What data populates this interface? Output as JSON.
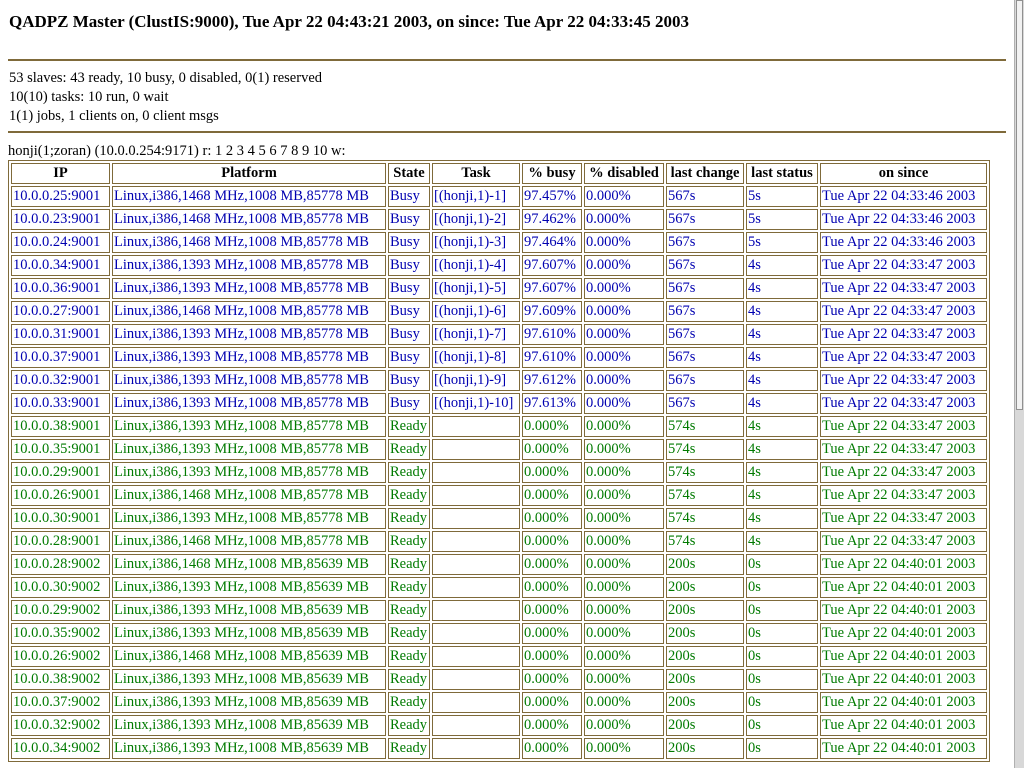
{
  "header": {
    "title": "QADPZ Master (ClustIS:9000), Tue Apr 22 04:43:21 2003, on since: Tue Apr 22 04:33:45 2003"
  },
  "summary": {
    "slaves": "53 slaves: 43 ready, 10 busy, 0 disabled, 0(1) reserved",
    "tasks": "10(10) tasks: 10 run, 0 wait",
    "jobs": "1(1) jobs, 1 clients on, 0 client msgs"
  },
  "job_line": "honji(1;zoran) (10.0.0.254:9171) r: 1 2 3 4 5 6 7 8 9 10 w:",
  "table": {
    "headers": [
      "IP",
      "Platform",
      "State",
      "Task",
      "% busy",
      "% disabled",
      "last change",
      "last status",
      "on since"
    ],
    "rows": [
      {
        "kind": "busy",
        "cells": [
          "10.0.0.25:9001",
          "Linux,i386,1468 MHz,1008 MB,85778 MB",
          "Busy",
          "[(honji,1)-1]",
          "97.457%",
          "0.000%",
          "567s",
          "5s",
          "Tue Apr 22 04:33:46 2003"
        ]
      },
      {
        "kind": "busy",
        "cells": [
          "10.0.0.23:9001",
          "Linux,i386,1468 MHz,1008 MB,85778 MB",
          "Busy",
          "[(honji,1)-2]",
          "97.462%",
          "0.000%",
          "567s",
          "5s",
          "Tue Apr 22 04:33:46 2003"
        ]
      },
      {
        "kind": "busy",
        "cells": [
          "10.0.0.24:9001",
          "Linux,i386,1468 MHz,1008 MB,85778 MB",
          "Busy",
          "[(honji,1)-3]",
          "97.464%",
          "0.000%",
          "567s",
          "5s",
          "Tue Apr 22 04:33:46 2003"
        ]
      },
      {
        "kind": "busy",
        "cells": [
          "10.0.0.34:9001",
          "Linux,i386,1393 MHz,1008 MB,85778 MB",
          "Busy",
          "[(honji,1)-4]",
          "97.607%",
          "0.000%",
          "567s",
          "4s",
          "Tue Apr 22 04:33:47 2003"
        ]
      },
      {
        "kind": "busy",
        "cells": [
          "10.0.0.36:9001",
          "Linux,i386,1393 MHz,1008 MB,85778 MB",
          "Busy",
          "[(honji,1)-5]",
          "97.607%",
          "0.000%",
          "567s",
          "4s",
          "Tue Apr 22 04:33:47 2003"
        ]
      },
      {
        "kind": "busy",
        "cells": [
          "10.0.0.27:9001",
          "Linux,i386,1468 MHz,1008 MB,85778 MB",
          "Busy",
          "[(honji,1)-6]",
          "97.609%",
          "0.000%",
          "567s",
          "4s",
          "Tue Apr 22 04:33:47 2003"
        ]
      },
      {
        "kind": "busy",
        "cells": [
          "10.0.0.31:9001",
          "Linux,i386,1393 MHz,1008 MB,85778 MB",
          "Busy",
          "[(honji,1)-7]",
          "97.610%",
          "0.000%",
          "567s",
          "4s",
          "Tue Apr 22 04:33:47 2003"
        ]
      },
      {
        "kind": "busy",
        "cells": [
          "10.0.0.37:9001",
          "Linux,i386,1393 MHz,1008 MB,85778 MB",
          "Busy",
          "[(honji,1)-8]",
          "97.610%",
          "0.000%",
          "567s",
          "4s",
          "Tue Apr 22 04:33:47 2003"
        ]
      },
      {
        "kind": "busy",
        "cells": [
          "10.0.0.32:9001",
          "Linux,i386,1393 MHz,1008 MB,85778 MB",
          "Busy",
          "[(honji,1)-9]",
          "97.612%",
          "0.000%",
          "567s",
          "4s",
          "Tue Apr 22 04:33:47 2003"
        ]
      },
      {
        "kind": "busy",
        "cells": [
          "10.0.0.33:9001",
          "Linux,i386,1393 MHz,1008 MB,85778 MB",
          "Busy",
          "[(honji,1)-10]",
          "97.613%",
          "0.000%",
          "567s",
          "4s",
          "Tue Apr 22 04:33:47 2003"
        ]
      },
      {
        "kind": "ready",
        "cells": [
          "10.0.0.38:9001",
          "Linux,i386,1393 MHz,1008 MB,85778 MB",
          "Ready",
          "",
          "0.000%",
          "0.000%",
          "574s",
          "4s",
          "Tue Apr 22 04:33:47 2003"
        ]
      },
      {
        "kind": "ready",
        "cells": [
          "10.0.0.35:9001",
          "Linux,i386,1393 MHz,1008 MB,85778 MB",
          "Ready",
          "",
          "0.000%",
          "0.000%",
          "574s",
          "4s",
          "Tue Apr 22 04:33:47 2003"
        ]
      },
      {
        "kind": "ready",
        "cells": [
          "10.0.0.29:9001",
          "Linux,i386,1393 MHz,1008 MB,85778 MB",
          "Ready",
          "",
          "0.000%",
          "0.000%",
          "574s",
          "4s",
          "Tue Apr 22 04:33:47 2003"
        ]
      },
      {
        "kind": "ready",
        "cells": [
          "10.0.0.26:9001",
          "Linux,i386,1468 MHz,1008 MB,85778 MB",
          "Ready",
          "",
          "0.000%",
          "0.000%",
          "574s",
          "4s",
          "Tue Apr 22 04:33:47 2003"
        ]
      },
      {
        "kind": "ready",
        "cells": [
          "10.0.0.30:9001",
          "Linux,i386,1393 MHz,1008 MB,85778 MB",
          "Ready",
          "",
          "0.000%",
          "0.000%",
          "574s",
          "4s",
          "Tue Apr 22 04:33:47 2003"
        ]
      },
      {
        "kind": "ready",
        "cells": [
          "10.0.0.28:9001",
          "Linux,i386,1468 MHz,1008 MB,85778 MB",
          "Ready",
          "",
          "0.000%",
          "0.000%",
          "574s",
          "4s",
          "Tue Apr 22 04:33:47 2003"
        ]
      },
      {
        "kind": "ready",
        "cells": [
          "10.0.0.28:9002",
          "Linux,i386,1468 MHz,1008 MB,85639 MB",
          "Ready",
          "",
          "0.000%",
          "0.000%",
          "200s",
          "0s",
          "Tue Apr 22 04:40:01 2003"
        ]
      },
      {
        "kind": "ready",
        "cells": [
          "10.0.0.30:9002",
          "Linux,i386,1393 MHz,1008 MB,85639 MB",
          "Ready",
          "",
          "0.000%",
          "0.000%",
          "200s",
          "0s",
          "Tue Apr 22 04:40:01 2003"
        ]
      },
      {
        "kind": "ready",
        "cells": [
          "10.0.0.29:9002",
          "Linux,i386,1393 MHz,1008 MB,85639 MB",
          "Ready",
          "",
          "0.000%",
          "0.000%",
          "200s",
          "0s",
          "Tue Apr 22 04:40:01 2003"
        ]
      },
      {
        "kind": "ready",
        "cells": [
          "10.0.0.35:9002",
          "Linux,i386,1393 MHz,1008 MB,85639 MB",
          "Ready",
          "",
          "0.000%",
          "0.000%",
          "200s",
          "0s",
          "Tue Apr 22 04:40:01 2003"
        ]
      },
      {
        "kind": "ready",
        "cells": [
          "10.0.0.26:9002",
          "Linux,i386,1468 MHz,1008 MB,85639 MB",
          "Ready",
          "",
          "0.000%",
          "0.000%",
          "200s",
          "0s",
          "Tue Apr 22 04:40:01 2003"
        ]
      },
      {
        "kind": "ready",
        "cells": [
          "10.0.0.38:9002",
          "Linux,i386,1393 MHz,1008 MB,85639 MB",
          "Ready",
          "",
          "0.000%",
          "0.000%",
          "200s",
          "0s",
          "Tue Apr 22 04:40:01 2003"
        ]
      },
      {
        "kind": "ready",
        "cells": [
          "10.0.0.37:9002",
          "Linux,i386,1393 MHz,1008 MB,85639 MB",
          "Ready",
          "",
          "0.000%",
          "0.000%",
          "200s",
          "0s",
          "Tue Apr 22 04:40:01 2003"
        ]
      },
      {
        "kind": "ready",
        "cells": [
          "10.0.0.32:9002",
          "Linux,i386,1393 MHz,1008 MB,85639 MB",
          "Ready",
          "",
          "0.000%",
          "0.000%",
          "200s",
          "0s",
          "Tue Apr 22 04:40:01 2003"
        ]
      },
      {
        "kind": "ready",
        "cells": [
          "10.0.0.34:9002",
          "Linux,i386,1393 MHz,1008 MB,85639 MB",
          "Ready",
          "",
          "0.000%",
          "0.000%",
          "200s",
          "0s",
          "Tue Apr 22 04:40:01 2003"
        ]
      }
    ]
  },
  "colors": {
    "busy_text": "#0000b0",
    "ready_text": "#007a00",
    "border": "#7f6a3a"
  }
}
